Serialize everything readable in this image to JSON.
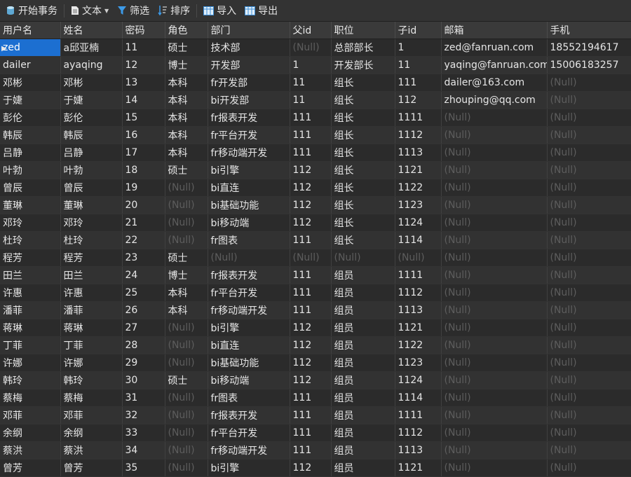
{
  "toolbar": {
    "begin_transaction": "开始事务",
    "text": "文本",
    "filter": "筛选",
    "sort": "排序",
    "import": "导入",
    "export": "导出"
  },
  "columns": [
    "用户名",
    "姓名",
    "密码",
    "角色",
    "部门",
    "父id",
    "职位",
    "子id",
    "邮箱",
    "手机"
  ],
  "null_text": "(Null)",
  "rows": [
    [
      "zed",
      "a邱亚楠",
      "11",
      "硕士",
      "技术部",
      null,
      "总部部长",
      "1",
      "zed@fanruan.com",
      "18552194617"
    ],
    [
      "dailer",
      "ayaqing",
      "12",
      "博士",
      "开发部",
      "1",
      "开发部长",
      "11",
      "yaqing@fanruan.com",
      "15006183257"
    ],
    [
      "邓彬",
      "邓彬",
      "13",
      "本科",
      "fr开发部",
      "11",
      "组长",
      "111",
      "dailer@163.com",
      null
    ],
    [
      "于婕",
      "于婕",
      "14",
      "本科",
      "bi开发部",
      "11",
      "组长",
      "112",
      "zhouping@qq.com",
      null
    ],
    [
      "彭伦",
      "彭伦",
      "15",
      "本科",
      "fr报表开发",
      "111",
      "组长",
      "1111",
      null,
      null
    ],
    [
      "韩辰",
      "韩辰",
      "16",
      "本科",
      "fr平台开发",
      "111",
      "组长",
      "1112",
      null,
      null
    ],
    [
      "吕静",
      "吕静",
      "17",
      "本科",
      "fr移动端开发",
      "111",
      "组长",
      "1113",
      null,
      null
    ],
    [
      "叶勃",
      "叶勃",
      "18",
      "硕士",
      "bi引擎",
      "112",
      "组长",
      "1121",
      null,
      null
    ],
    [
      "曾辰",
      "曾辰",
      "19",
      null,
      "bi直连",
      "112",
      "组长",
      "1122",
      null,
      null
    ],
    [
      "董琳",
      "董琳",
      "20",
      null,
      "bi基础功能",
      "112",
      "组长",
      "1123",
      null,
      null
    ],
    [
      "邓玲",
      "邓玲",
      "21",
      null,
      "bi移动端",
      "112",
      "组长",
      "1124",
      null,
      null
    ],
    [
      "杜玲",
      "杜玲",
      "22",
      null,
      "fr图表",
      "111",
      "组长",
      "1114",
      null,
      null
    ],
    [
      "程芳",
      "程芳",
      "23",
      "硕士",
      null,
      null,
      null,
      null,
      null,
      null
    ],
    [
      "田兰",
      "田兰",
      "24",
      "博士",
      "fr报表开发",
      "111",
      "组员",
      "1111",
      null,
      null
    ],
    [
      "许惠",
      "许惠",
      "25",
      "本科",
      "fr平台开发",
      "111",
      "组员",
      "1112",
      null,
      null
    ],
    [
      "潘菲",
      "潘菲",
      "26",
      "本科",
      "fr移动端开发",
      "111",
      "组员",
      "1113",
      null,
      null
    ],
    [
      "蒋琳",
      "蒋琳",
      "27",
      null,
      "bi引擎",
      "112",
      "组员",
      "1121",
      null,
      null
    ],
    [
      "丁菲",
      "丁菲",
      "28",
      null,
      "bi直连",
      "112",
      "组员",
      "1122",
      null,
      null
    ],
    [
      "许娜",
      "许娜",
      "29",
      null,
      "bi基础功能",
      "112",
      "组员",
      "1123",
      null,
      null
    ],
    [
      "韩玲",
      "韩玲",
      "30",
      "硕士",
      "bi移动端",
      "112",
      "组员",
      "1124",
      null,
      null
    ],
    [
      "蔡梅",
      "蔡梅",
      "31",
      null,
      "fr图表",
      "111",
      "组员",
      "1114",
      null,
      null
    ],
    [
      "邓菲",
      "邓菲",
      "32",
      null,
      "fr报表开发",
      "111",
      "组员",
      "1111",
      null,
      null
    ],
    [
      "余纲",
      "余纲",
      "33",
      null,
      "fr平台开发",
      "111",
      "组员",
      "1112",
      null,
      null
    ],
    [
      "蔡洪",
      "蔡洪",
      "34",
      null,
      "fr移动端开发",
      "111",
      "组员",
      "1113",
      null,
      null
    ],
    [
      "曾芳",
      "曾芳",
      "35",
      null,
      "bi引擎",
      "112",
      "组员",
      "1121",
      null,
      null
    ]
  ],
  "row_marker": "▶",
  "colors": {
    "selection": "#1c6fd1",
    "null_text": "#5d5d5d",
    "background": "#2b2b2b"
  }
}
